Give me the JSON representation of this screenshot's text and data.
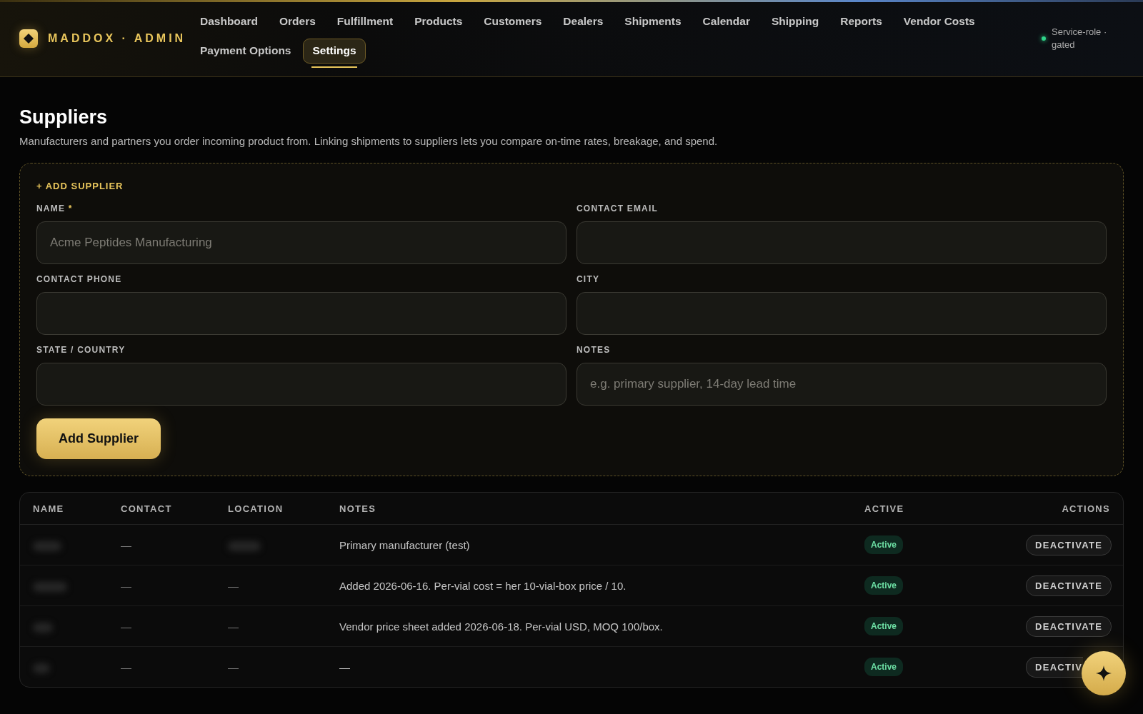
{
  "brand": {
    "name": "MADDOX · ADMIN"
  },
  "nav": [
    {
      "label": "Dashboard",
      "selected": false
    },
    {
      "label": "Orders",
      "selected": false
    },
    {
      "label": "Fulfillment",
      "selected": false
    },
    {
      "label": "Products",
      "selected": false
    },
    {
      "label": "Customers",
      "selected": false
    },
    {
      "label": "Dealers",
      "selected": false
    },
    {
      "label": "Shipments",
      "selected": false
    },
    {
      "label": "Calendar",
      "selected": false
    },
    {
      "label": "Shipping",
      "selected": false
    },
    {
      "label": "Reports",
      "selected": false
    },
    {
      "label": "Vendor Costs",
      "selected": false
    },
    {
      "label": "Payment Options",
      "selected": false
    },
    {
      "label": "Settings",
      "selected": true
    }
  ],
  "status": {
    "label": "Service-role · gated",
    "color": "#2fd58a"
  },
  "page": {
    "title": "Suppliers",
    "description": "Manufacturers and partners you order incoming product from. Linking shipments to suppliers lets you compare on-time rates, breakage, and spend."
  },
  "form": {
    "heading": "+ ADD SUPPLIER",
    "fields": [
      {
        "label": "NAME",
        "required_mark": "*",
        "placeholder": "Acme Peptides Manufacturing"
      },
      {
        "label": "CONTACT EMAIL"
      },
      {
        "label": "CONTACT PHONE"
      },
      {
        "label": "CITY"
      },
      {
        "label": "STATE / COUNTRY"
      },
      {
        "label": "NOTES",
        "placeholder": "e.g. primary supplier, 14-day lead time"
      }
    ],
    "submit": "Add Supplier"
  },
  "table": {
    "columns": [
      "NAME",
      "CONTACT",
      "LOCATION",
      "NOTES",
      "ACTIVE",
      "ACTIONS"
    ],
    "rows": [
      {
        "name_redacted": true,
        "contact": "—",
        "location_redacted": true,
        "notes": "Primary manufacturer (test)",
        "active": "Active",
        "action": "DEACTIVATE"
      },
      {
        "name_redacted": true,
        "contact": "—",
        "location": "—",
        "notes": "Added 2026-06-16. Per-vial cost = her 10-vial-box price / 10.",
        "active": "Active",
        "action": "DEACTIVATE"
      },
      {
        "name_redacted": true,
        "contact": "—",
        "location": "—",
        "notes": "Vendor price sheet added 2026-06-18. Per-vial USD, MOQ 100/box.",
        "active": "Active",
        "action": "DEACTIVATE"
      },
      {
        "name_redacted": true,
        "contact": "—",
        "location": "—",
        "notes": "—",
        "active": "Active",
        "action": "DEACTIV",
        "action_partly_covered": true
      }
    ]
  }
}
